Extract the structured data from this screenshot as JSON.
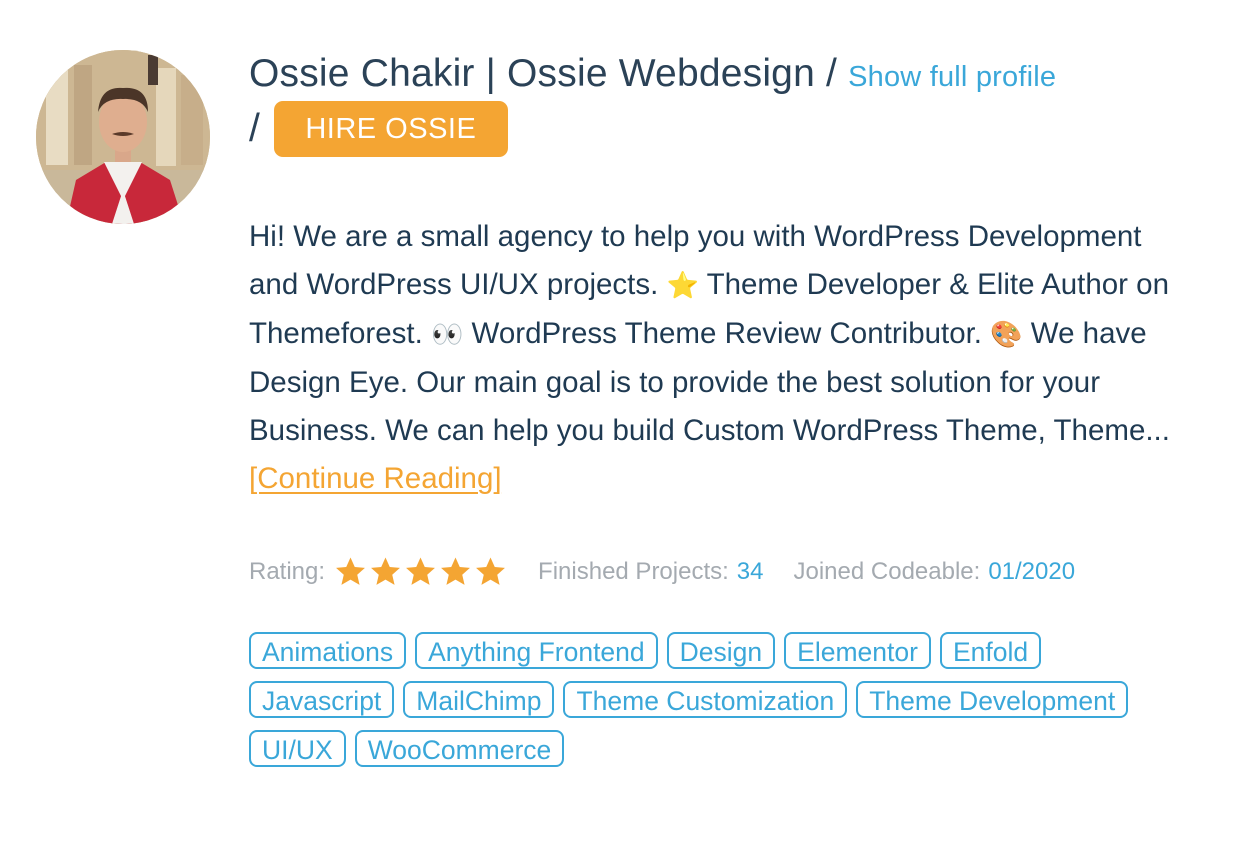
{
  "profile": {
    "avatar_alt": "Ossie Chakir profile photo",
    "name": "Ossie Chakir | Ossie Webdesign",
    "separator": "/",
    "show_full_profile_label": "Show full profile",
    "hire_button_label": "HIRE OSSIE"
  },
  "bio": {
    "segments": [
      "Hi! We are a small agency to help you with WordPress Development and WordPress UI/UX projects. ",
      " Theme Developer & Elite Author on Themeforest. ",
      " WordPress Theme Review Contributor. ",
      " We have Design Eye. Our main goal is to provide the best solution for your Business. We can help you build Custom WordPress Theme, Theme... "
    ],
    "emojis": [
      "star-emoji",
      "eyes-emoji",
      "palette-emoji"
    ],
    "emoji_glyphs": [
      "⭐",
      "👀",
      "🎨"
    ],
    "continue_reading_label": "[Continue Reading]"
  },
  "stats": {
    "rating_label": "Rating:",
    "rating_value": 5,
    "rating_max": 5,
    "finished_projects_label": "Finished Projects:",
    "finished_projects_value": "34",
    "joined_label": "Joined Codeable:",
    "joined_value": "01/2020"
  },
  "tags": [
    "Animations",
    "Anything Frontend",
    "Design",
    "Elementor",
    "Enfold",
    "Javascript",
    "MailChimp",
    "Theme Customization",
    "Theme Development",
    "UI/UX",
    "WooCommerce"
  ],
  "colors": {
    "accent_orange": "#f4a533",
    "link_blue": "#3aa7d9",
    "text_dark": "#1f3a52",
    "text_muted": "#a4aab0"
  }
}
